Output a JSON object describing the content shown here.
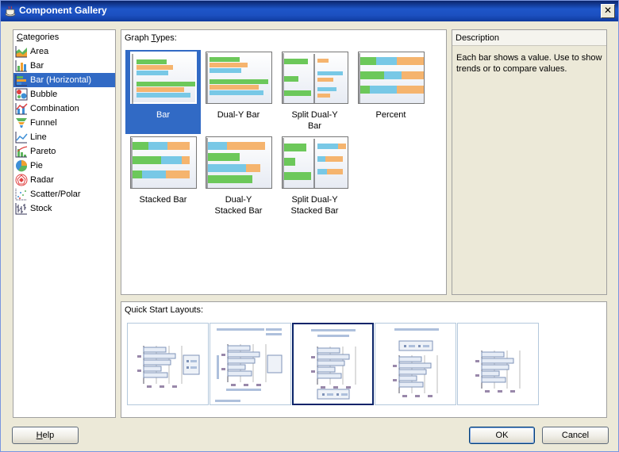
{
  "window": {
    "title": "Component Gallery",
    "close_label": "✕"
  },
  "categories": {
    "header_prefix": "C",
    "header_rest": "ategories",
    "items": [
      {
        "label": "Area",
        "icon": "area-chart-icon"
      },
      {
        "label": "Bar",
        "icon": "bar-chart-icon"
      },
      {
        "label": "Bar (Horizontal)",
        "icon": "horizontal-bar-chart-icon",
        "selected": true
      },
      {
        "label": "Bubble",
        "icon": "bubble-chart-icon"
      },
      {
        "label": "Combination",
        "icon": "combination-chart-icon"
      },
      {
        "label": "Funnel",
        "icon": "funnel-chart-icon"
      },
      {
        "label": "Line",
        "icon": "line-chart-icon"
      },
      {
        "label": "Pareto",
        "icon": "pareto-chart-icon"
      },
      {
        "label": "Pie",
        "icon": "pie-chart-icon"
      },
      {
        "label": "Radar",
        "icon": "radar-chart-icon"
      },
      {
        "label": "Scatter/Polar",
        "icon": "scatter-chart-icon"
      },
      {
        "label": "Stock",
        "icon": "stock-chart-icon"
      }
    ]
  },
  "graph_types": {
    "label_prefix": "Graph ",
    "label_mnemonic": "T",
    "label_rest": "ypes:",
    "tiles": [
      {
        "line1": "Bar",
        "line2": "",
        "selected": true
      },
      {
        "line1": "Dual-Y Bar",
        "line2": ""
      },
      {
        "line1": "Split Dual-Y",
        "line2": "Bar"
      },
      {
        "line1": "Percent",
        "line2": ""
      },
      {
        "line1": "Stacked Bar",
        "line2": ""
      },
      {
        "line1": "Dual-Y",
        "line2": "Stacked Bar"
      },
      {
        "line1": "Split Dual-Y",
        "line2": "Stacked Bar"
      }
    ]
  },
  "description": {
    "header": "Description",
    "text": "Each bar shows a value. Use to show trends or to compare values."
  },
  "quick_start": {
    "label": "Quick Start Layouts:",
    "selected_index": 2
  },
  "buttons": {
    "help_mnemonic": "H",
    "help_rest": "elp",
    "ok": "OK",
    "cancel": "Cancel"
  },
  "colors": {
    "selection": "#316ac5",
    "bar_green": "#6cc85a",
    "bar_orange": "#f5b46e",
    "bar_blue": "#78c8e6"
  }
}
